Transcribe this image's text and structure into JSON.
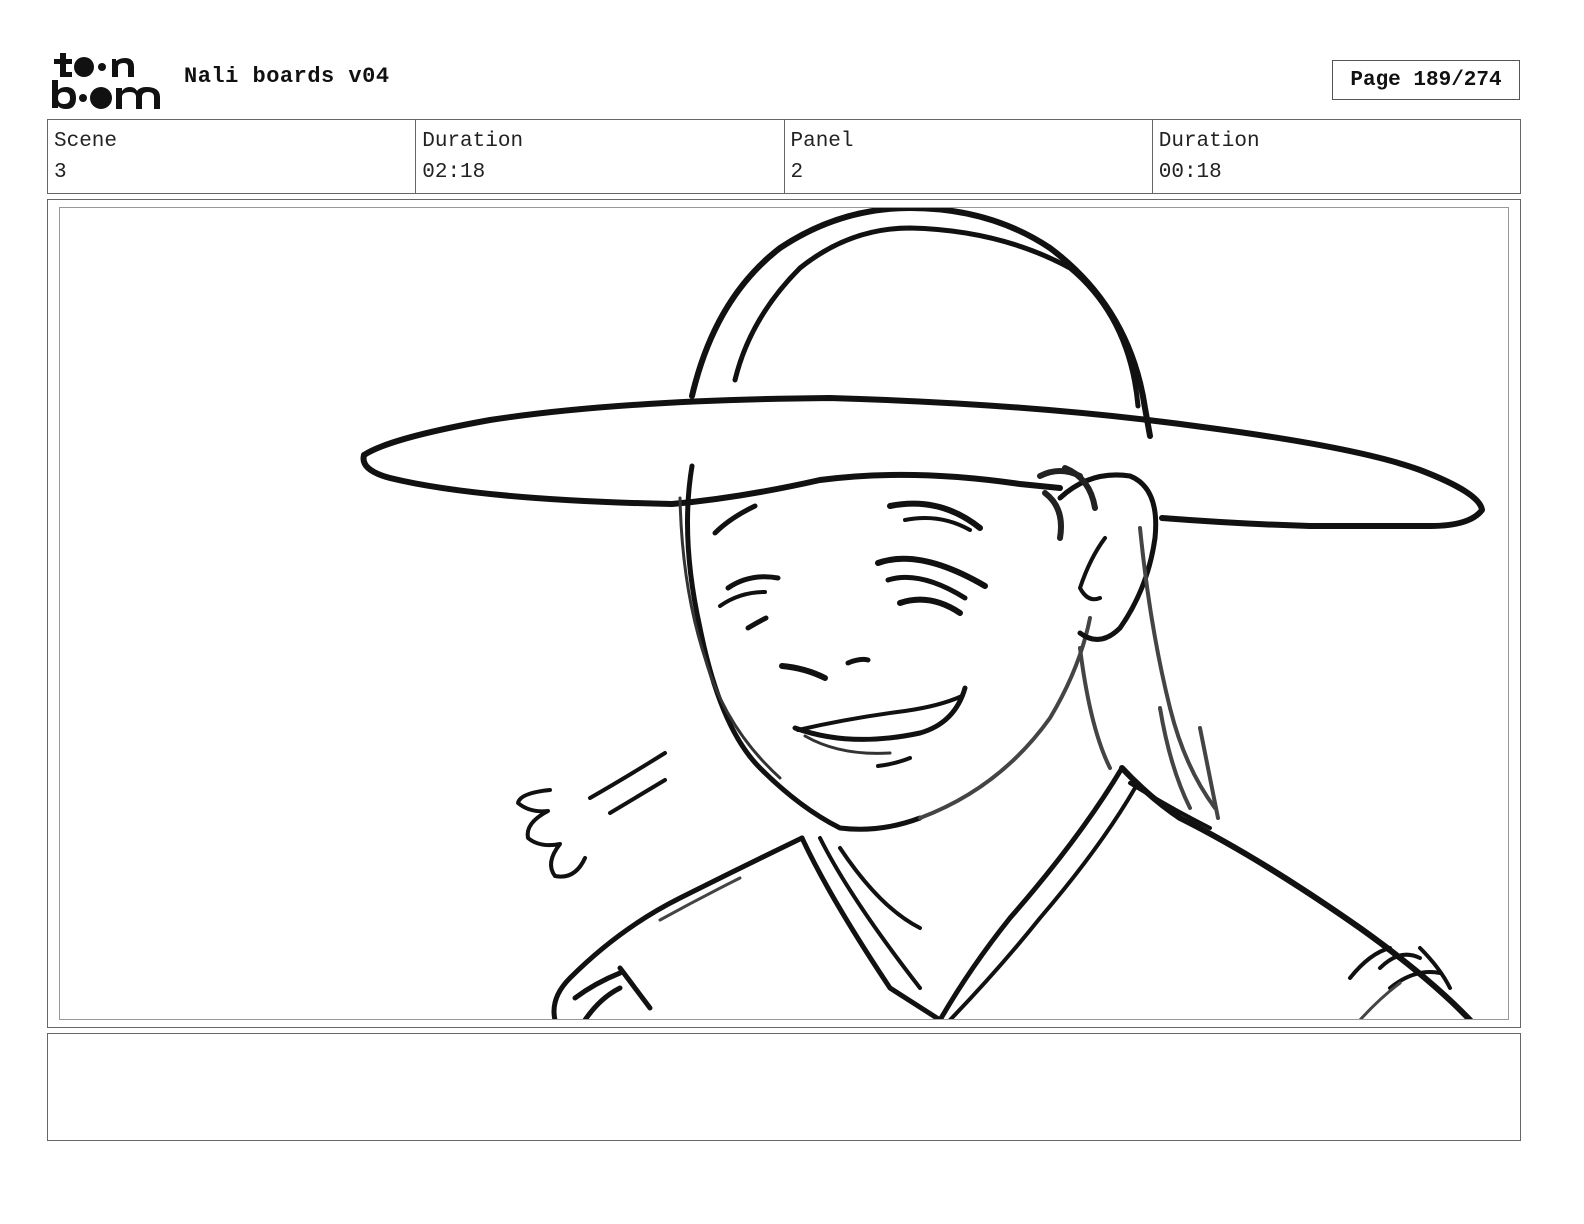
{
  "header": {
    "logo_text_top": "toon",
    "logo_text_bottom": "boom",
    "title": "Nali boards v04",
    "page_label": "Page 189/274"
  },
  "info": {
    "scene_label": "Scene",
    "scene_value": "3",
    "scene_duration_label": "Duration",
    "scene_duration_value": "02:18",
    "panel_label": "Panel",
    "panel_value": "2",
    "panel_duration_label": "Duration",
    "panel_duration_value": "00:18"
  },
  "panel": {
    "image_description_icon": "character-sketch",
    "notes": ""
  }
}
